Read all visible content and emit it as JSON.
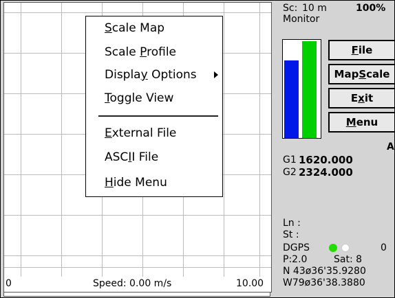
{
  "header": {
    "scale_label": "Sc:",
    "scale_value": "10 m",
    "zoom": "100%",
    "mode": "Monitor"
  },
  "menu": {
    "items": [
      {
        "pre": "",
        "ul": "S",
        "post": "cale Map"
      },
      {
        "pre": "Scale ",
        "ul": "P",
        "post": "rofile"
      },
      {
        "pre": "Displa",
        "ul": "y",
        "post": " Options"
      },
      {
        "pre": "",
        "ul": "T",
        "post": "oggle View"
      },
      {
        "pre": "",
        "ul": "E",
        "post": "xternal File"
      },
      {
        "pre": "ASC",
        "ul": "I",
        "post": "I File"
      },
      {
        "pre": "",
        "ul": "H",
        "post": "ide Menu"
      }
    ]
  },
  "speedbar": {
    "min": "0",
    "speed_text": "Speed: 0.00 m/s",
    "max": "10.00"
  },
  "bars": {
    "bar1_level": 0.8,
    "bar2_level": 1.0,
    "colors": {
      "blue": "#0018e8",
      "green": "#00d000"
    }
  },
  "buttons": [
    {
      "pre": "",
      "ul": "F",
      "post": "ile"
    },
    {
      "pre": "Map",
      "ul": "S",
      "post": "cale"
    },
    {
      "pre": "E",
      "ul": "x",
      "post": "it"
    },
    {
      "pre": "",
      "ul": "M",
      "post": "enu"
    }
  ],
  "readings": {
    "corner_letter": "A",
    "g1_label": "G1",
    "g1_value": "1620.000",
    "g2_label": "G2",
    "g2_value": "2324.000",
    "ln_label": "Ln :",
    "st_label": "St :",
    "dgps_label": "DGPS",
    "dgps_count": "0",
    "p_label": "P:2.0",
    "sat_label": "Sat: 8",
    "lat": "N 43ø36'35.9280",
    "lon": "W79ø36'38.3880"
  },
  "leds": {
    "green": "#22dd00",
    "white": "#ffffff"
  }
}
